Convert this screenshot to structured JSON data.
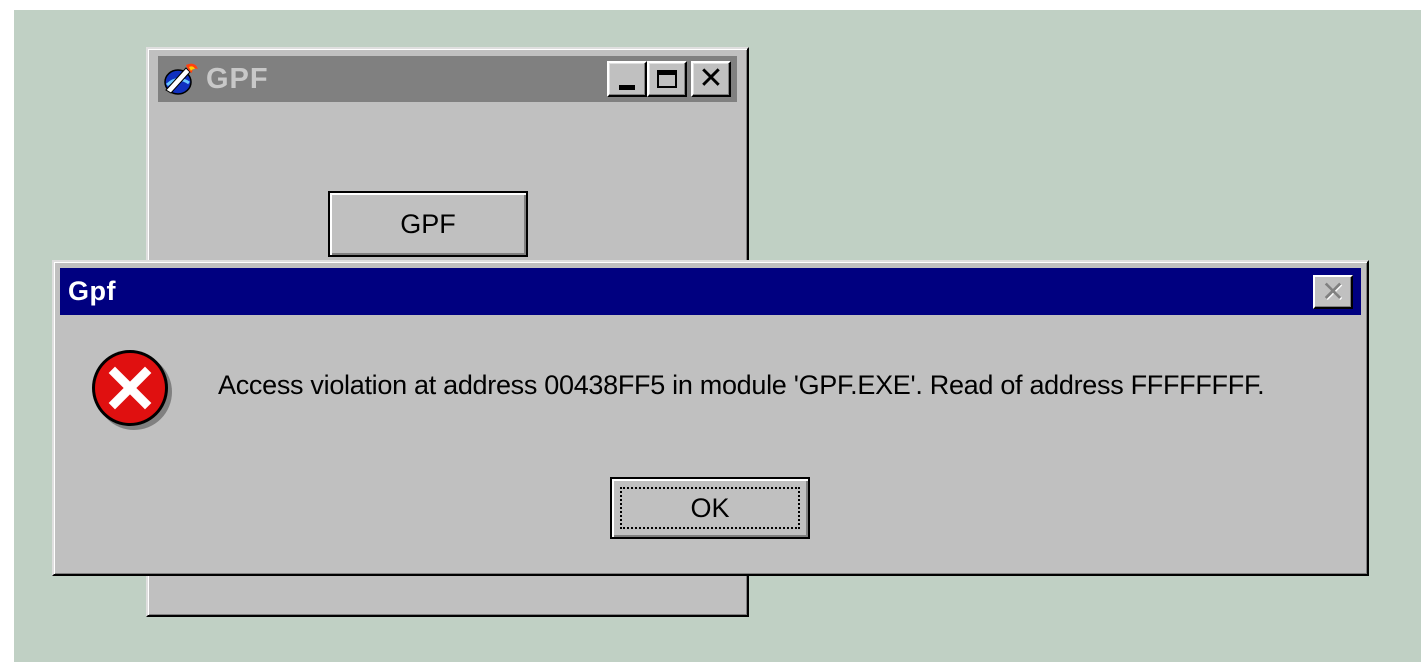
{
  "background_window": {
    "title": "GPF",
    "icon": "flame-globe-app-icon",
    "caption_buttons": {
      "minimize": "minimize-icon",
      "maximize": "maximize-icon",
      "close": "close-icon"
    },
    "button_label": "GPF"
  },
  "dialog": {
    "title": "Gpf",
    "icon": "error-icon",
    "message": "Access violation at address 00438FF5 in module 'GPF.EXE'. Read of address FFFFFFFF.",
    "ok_label": "OK"
  },
  "colors": {
    "desktop": "#c0d0c4",
    "window_face": "#c0c0c0",
    "active_title": "#000080",
    "inactive_title": "#808080",
    "error_red": "#e01010"
  }
}
